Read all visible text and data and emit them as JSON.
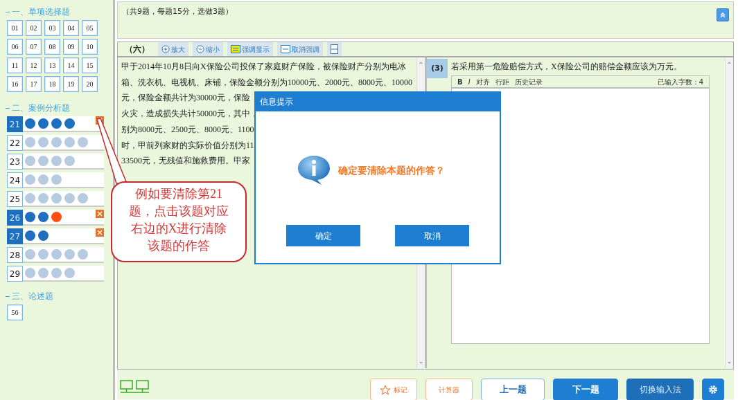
{
  "sidebar": {
    "sections": [
      {
        "title": "一、单项选择题",
        "expanded": true,
        "kind": "grid",
        "items": [
          {
            "label": "01"
          },
          {
            "label": "02"
          },
          {
            "label": "03"
          },
          {
            "label": "04"
          },
          {
            "label": "05"
          },
          {
            "label": "06"
          },
          {
            "label": "07"
          },
          {
            "label": "08"
          },
          {
            "label": "09"
          },
          {
            "label": "10"
          },
          {
            "label": "11"
          },
          {
            "label": "12"
          },
          {
            "label": "13"
          },
          {
            "label": "14"
          },
          {
            "label": "15"
          },
          {
            "label": "16"
          },
          {
            "label": "17"
          },
          {
            "label": "18"
          },
          {
            "label": "19"
          },
          {
            "label": "20"
          }
        ]
      },
      {
        "title": "二、案例分析题",
        "expanded": true,
        "kind": "rows",
        "items": [
          {
            "label": "21",
            "answered": true,
            "clearable": true,
            "dots": [
              {
                "color": "#1e6fbf"
              },
              {
                "color": "#1e6fbf"
              },
              {
                "color": "#1e6fbf"
              },
              {
                "color": "#1e6fbf"
              }
            ]
          },
          {
            "label": "22",
            "answered": false,
            "clearable": false,
            "dots": [
              {
                "color": "#b6cbe0"
              },
              {
                "color": "#b6cbe0"
              },
              {
                "color": "#b6cbe0"
              },
              {
                "color": "#b6cbe0"
              },
              {
                "color": "#b6cbe0"
              }
            ]
          },
          {
            "label": "23",
            "answered": false,
            "clearable": false,
            "dots": [
              {
                "color": "#b6cbe0"
              },
              {
                "color": "#b6cbe0"
              },
              {
                "color": "#b6cbe0"
              },
              {
                "color": "#b6cbe0"
              }
            ]
          },
          {
            "label": "24",
            "answered": false,
            "clearable": false,
            "dots": [
              {
                "color": "#b6cbe0"
              },
              {
                "color": "#b6cbe0"
              },
              {
                "color": "#b6cbe0"
              }
            ]
          },
          {
            "label": "25",
            "answered": false,
            "clearable": false,
            "dots": [
              {
                "color": "#b6cbe0"
              },
              {
                "color": "#b6cbe0"
              },
              {
                "color": "#b6cbe0"
              },
              {
                "color": "#b6cbe0"
              },
              {
                "color": "#b6cbe0"
              }
            ]
          },
          {
            "label": "26",
            "answered": true,
            "clearable": true,
            "dots": [
              {
                "color": "#1e6fbf"
              },
              {
                "color": "#1e6fbf"
              },
              {
                "color": "#ff4f12"
              }
            ]
          },
          {
            "label": "27",
            "answered": true,
            "clearable": true,
            "dots": [
              {
                "color": "#1e6fbf"
              },
              {
                "color": "#1e6fbf"
              }
            ]
          },
          {
            "label": "28",
            "answered": false,
            "clearable": false,
            "dots": [
              {
                "color": "#b6cbe0"
              },
              {
                "color": "#b6cbe0"
              },
              {
                "color": "#b6cbe0"
              },
              {
                "color": "#b6cbe0"
              },
              {
                "color": "#b6cbe0"
              }
            ]
          },
          {
            "label": "29",
            "answered": false,
            "clearable": false,
            "dots": [
              {
                "color": "#b6cbe0"
              },
              {
                "color": "#b6cbe0"
              },
              {
                "color": "#b6cbe0"
              },
              {
                "color": "#b6cbe0"
              }
            ]
          }
        ]
      },
      {
        "title": "三、论述题",
        "expanded": true,
        "kind": "grid",
        "items": [
          {
            "label": "56"
          }
        ]
      }
    ]
  },
  "header": {
    "note": "（共9题，每题15分，选做3题）"
  },
  "toolbar": {
    "title": "（六）",
    "buttons": [
      {
        "kind": "zoom-in",
        "label": "放大"
      },
      {
        "kind": "zoom-out",
        "label": "缩小"
      },
      {
        "kind": "highlight",
        "label": "强调显示"
      },
      {
        "kind": "unhighlight",
        "label": "取消强调"
      },
      {
        "kind": "split"
      }
    ]
  },
  "passage": {
    "lines": [
      "甲于2014年10月8日向X保险公司投保了家庭财产保险，被保险财产分别为电冰",
      "箱、洗衣机、电视机、床铺，保险金额分别为10000元、2000元、8000元、10000",
      "元，保险金额共计为30000元，保险",
      "火灾，造成损失共计50000元，其中，",
      "别为8000元、2500元、8000元、1100",
      "时，甲前列家财的实际价值分别为11",
      "33500元，无残值和施救费用。甲家"
    ]
  },
  "question": {
    "number": "(3)",
    "text": "若采用第一危险赔偿方式，X保险公司的赔偿金额应该为万元。",
    "editor": {
      "tools": [
        {
          "kind": "bold",
          "label": "B"
        },
        {
          "kind": "italic",
          "label": "I"
        },
        {
          "kind": "text",
          "label": "对齐"
        },
        {
          "kind": "text",
          "label": "行距"
        },
        {
          "kind": "text",
          "label": "历史记录"
        }
      ],
      "count": "已输入字数：4"
    }
  },
  "footer": {
    "buttons": [
      {
        "kind": "mark",
        "label": "标记"
      },
      {
        "kind": "calculator",
        "label": "计算器"
      },
      {
        "kind": "prev",
        "label": "上一题"
      },
      {
        "kind": "next",
        "label": "下一题"
      },
      {
        "kind": "ime",
        "label": "切换输入法"
      },
      {
        "kind": "settings"
      }
    ]
  },
  "dialog": {
    "title": "信息提示",
    "message": "确定要清除本题的作答？",
    "buttons": [
      "确定",
      "取消"
    ]
  },
  "callout": {
    "lines": [
      "例如要清除第21",
      "题，点击该题对应",
      "右边的X进行清除",
      "该题的作答"
    ]
  }
}
